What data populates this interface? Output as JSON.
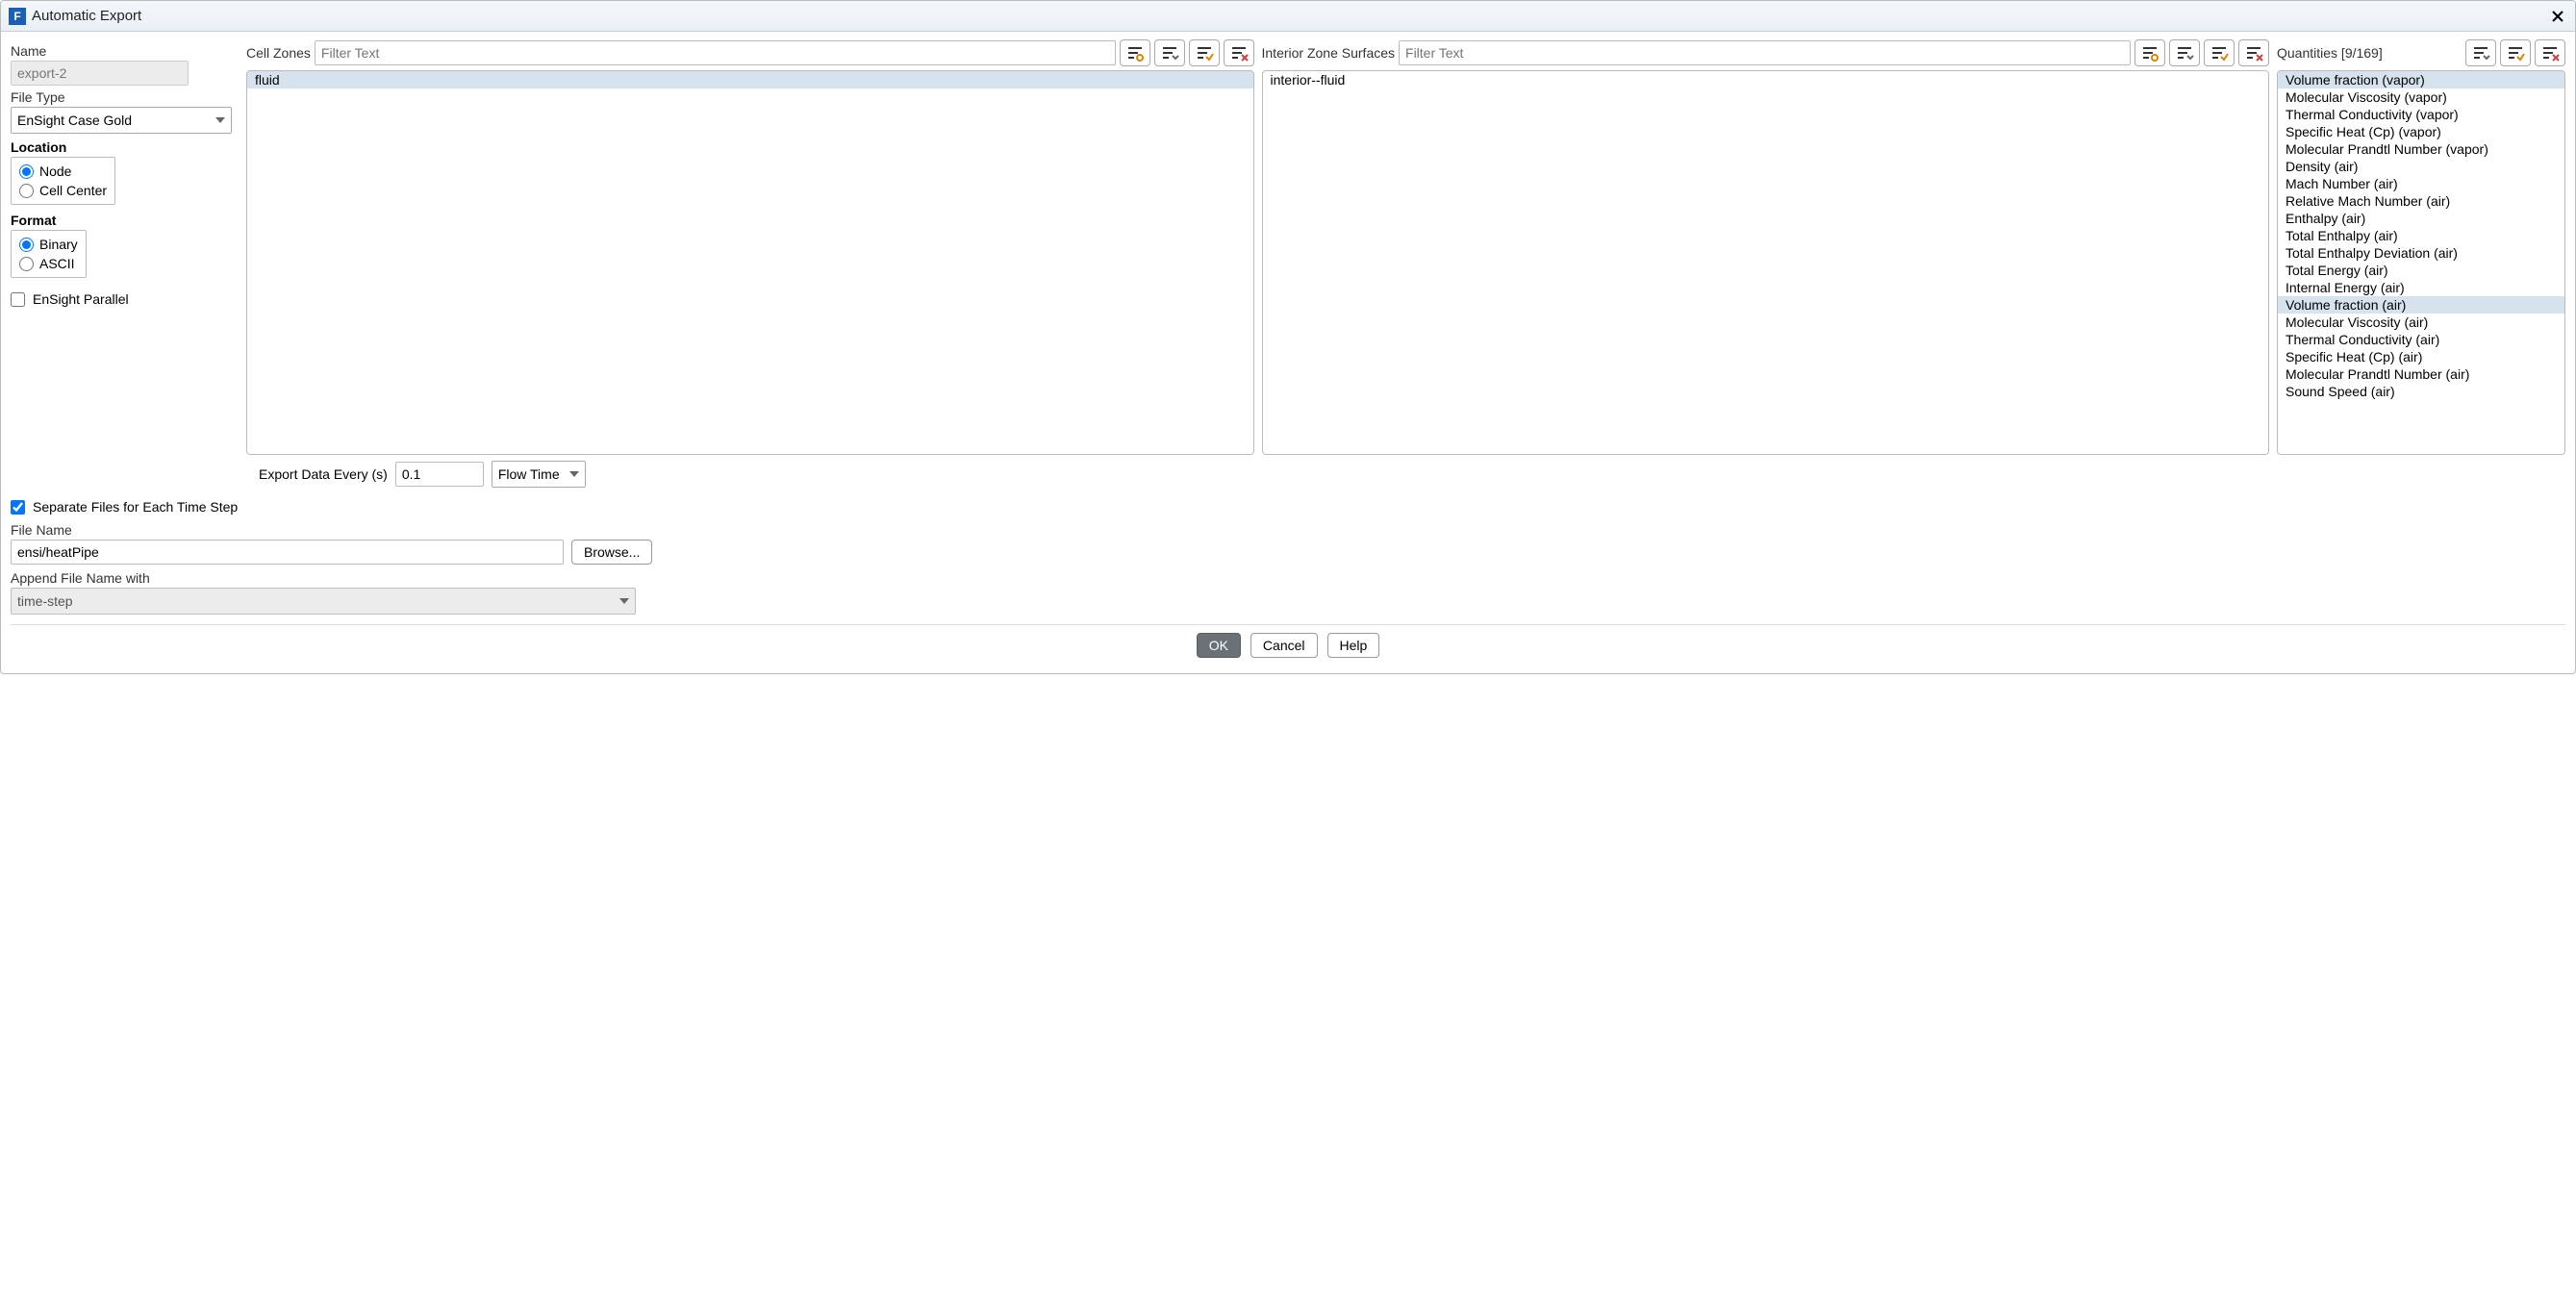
{
  "window": {
    "title": "Automatic Export"
  },
  "left": {
    "name_label": "Name",
    "name_value": "export-2",
    "filetype_label": "File Type",
    "filetype_value": "EnSight Case Gold",
    "location_label": "Location",
    "location_node": "Node",
    "location_cell": "Cell Center",
    "format_label": "Format",
    "format_binary": "Binary",
    "format_ascii": "ASCII",
    "ensight_parallel": "EnSight Parallel"
  },
  "cellzones": {
    "label": "Cell Zones",
    "placeholder": "Filter Text",
    "items": [
      "fluid"
    ],
    "selected": [
      0
    ]
  },
  "interiorzones": {
    "label": "Interior Zone Surfaces",
    "placeholder": "Filter Text",
    "items": [
      "interior--fluid"
    ],
    "selected": []
  },
  "quantities": {
    "label": "Quantities [9/169]",
    "items": [
      "Volume fraction (vapor)",
      "Molecular Viscosity (vapor)",
      "Thermal Conductivity (vapor)",
      "Specific Heat (Cp) (vapor)",
      "Molecular Prandtl Number (vapor)",
      "Density (air)",
      "Mach Number (air)",
      "Relative Mach Number (air)",
      "Enthalpy (air)",
      "Total Enthalpy (air)",
      "Total Enthalpy Deviation (air)",
      "Total Energy (air)",
      "Internal Energy (air)",
      "Volume fraction (air)",
      "Molecular Viscosity (air)",
      "Thermal Conductivity (air)",
      "Specific Heat (Cp) (air)",
      "Molecular Prandtl Number (air)",
      "Sound Speed (air)"
    ],
    "selected": [
      0,
      13
    ]
  },
  "export_every": {
    "label": "Export Data Every (s)",
    "value": "0.1",
    "unit_value": "Flow Time"
  },
  "sep_files": "Separate Files for Each Time Step",
  "filename": {
    "label": "File Name",
    "value": "ensi/heatPipe",
    "browse": "Browse..."
  },
  "append": {
    "label": "Append File Name with",
    "value": "time-step"
  },
  "buttons": {
    "ok": "OK",
    "cancel": "Cancel",
    "help": "Help"
  }
}
